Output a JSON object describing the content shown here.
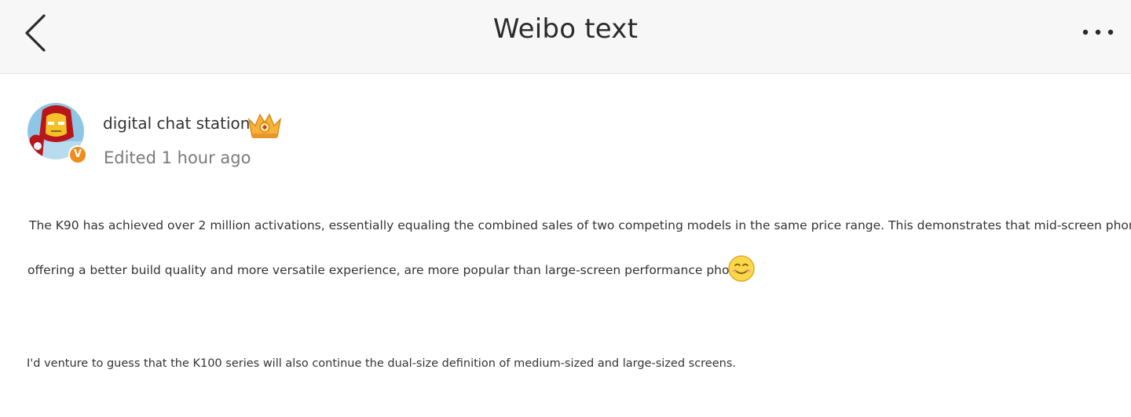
{
  "header": {
    "title": "Weibo text",
    "back_icon": "chevron-left-icon",
    "more_icon": "more-dots-icon"
  },
  "post": {
    "author": {
      "name": "digital chat station",
      "avatar_icon": "iron-man-avatar",
      "verified_badge": "V",
      "member_badge_icon": "crown-badge-icon"
    },
    "edited": "Edited 1 hour ago",
    "paragraphs": [
      {
        "line1": "The K90 has achieved over 2 million activations, essentially equaling the combined sales of two competing models in the same price range. This demonstrates that mid-screen phones,",
        "line2": "offering a better build quality and more versatile experience, are more popular than large-screen performance phones.",
        "emoji": "smile-emoji"
      },
      {
        "text": "I'd venture to guess that the K100 series will also continue the dual-size definition of medium-sized and large-sized screens."
      }
    ]
  },
  "colors": {
    "header_bg": "#f7f7f7",
    "text": "#333333",
    "muted": "#7a7a7a",
    "verified_orange": "#f08c1a"
  }
}
